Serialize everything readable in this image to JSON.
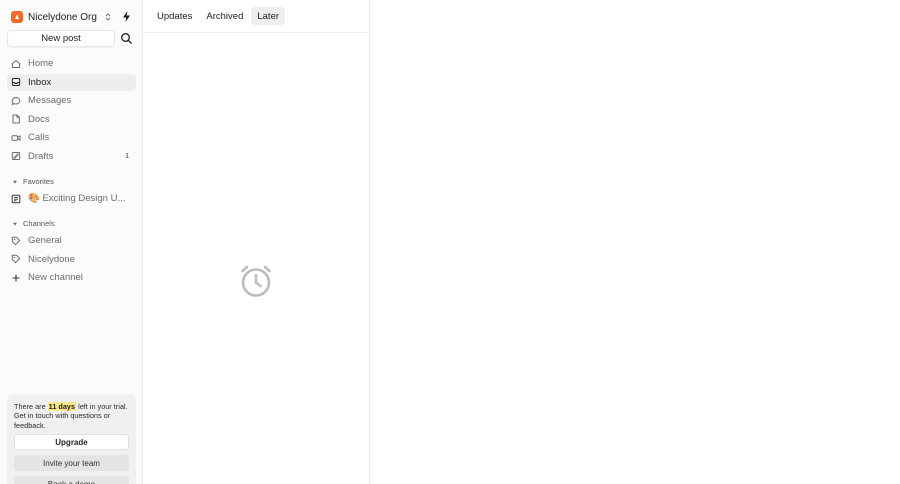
{
  "org": {
    "name": "Nicelydone Org",
    "logo_color": "#f26b2a"
  },
  "sidebar": {
    "new_post": "New post",
    "nav": [
      {
        "label": "Home",
        "icon": "home-icon",
        "active": false
      },
      {
        "label": "Inbox",
        "icon": "inbox-icon",
        "active": true
      },
      {
        "label": "Messages",
        "icon": "message-icon",
        "active": false
      },
      {
        "label": "Docs",
        "icon": "doc-icon",
        "active": false
      },
      {
        "label": "Calls",
        "icon": "video-icon",
        "active": false
      },
      {
        "label": "Drafts",
        "icon": "drafts-icon",
        "active": false,
        "badge": "1"
      }
    ],
    "favorites": {
      "title": "Favorites",
      "items": [
        {
          "label": "🎨 Exciting Design U...",
          "icon": "doc-list-icon"
        }
      ]
    },
    "channels": {
      "title": "Channels",
      "items": [
        {
          "label": "General",
          "icon": "channel-icon"
        },
        {
          "label": "Nicelydone",
          "icon": "channel-icon"
        },
        {
          "label": "New channel",
          "icon": "plus-icon"
        }
      ]
    },
    "trial": {
      "before": "There are ",
      "days": "11 days",
      "after": " left in your trial. Get in touch with questions or feedback.",
      "highlight_color": "#fde58a",
      "upgrade": "Upgrade",
      "invite": "Invite your team",
      "demo": "Book a demo"
    }
  },
  "list": {
    "tabs": [
      {
        "label": "Updates",
        "active": false
      },
      {
        "label": "Archived",
        "active": false
      },
      {
        "label": "Later",
        "active": true
      }
    ],
    "empty_icon": "alarm-clock-icon"
  }
}
